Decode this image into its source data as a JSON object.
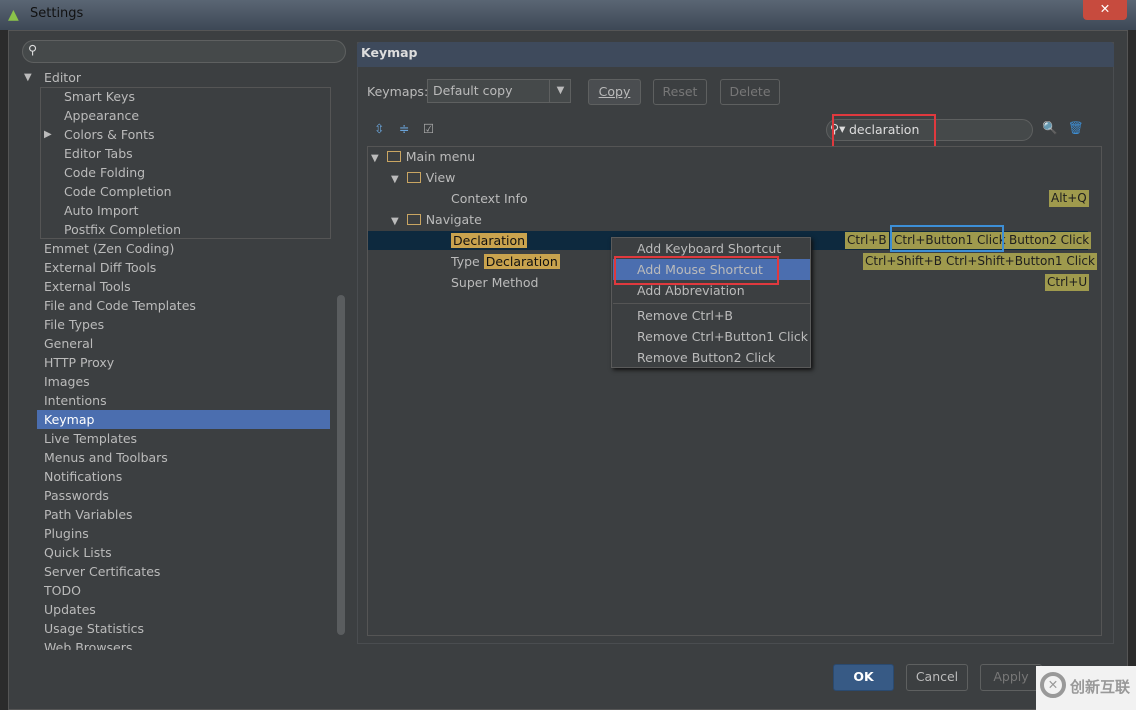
{
  "window": {
    "title": "Settings",
    "close": "✕"
  },
  "sidebar": {
    "search_placeholder": "",
    "items": [
      {
        "label": "Editor",
        "level": 0,
        "arrow": "▼"
      },
      {
        "label": "Smart Keys",
        "level": 1
      },
      {
        "label": "Appearance",
        "level": 1
      },
      {
        "label": "Colors & Fonts",
        "level": 1,
        "arrow": "▶"
      },
      {
        "label": "Editor Tabs",
        "level": 1
      },
      {
        "label": "Code Folding",
        "level": 1
      },
      {
        "label": "Code Completion",
        "level": 1
      },
      {
        "label": "Auto Import",
        "level": 1
      },
      {
        "label": "Postfix Completion",
        "level": 1
      },
      {
        "label": "Emmet (Zen Coding)"
      },
      {
        "label": "External Diff Tools"
      },
      {
        "label": "External Tools"
      },
      {
        "label": "File and Code Templates"
      },
      {
        "label": "File Types"
      },
      {
        "label": "General"
      },
      {
        "label": "HTTP Proxy"
      },
      {
        "label": "Images"
      },
      {
        "label": "Intentions"
      },
      {
        "label": "Keymap",
        "selected": true
      },
      {
        "label": "Live Templates"
      },
      {
        "label": "Menus and Toolbars"
      },
      {
        "label": "Notifications"
      },
      {
        "label": "Passwords"
      },
      {
        "label": "Path Variables"
      },
      {
        "label": "Plugins"
      },
      {
        "label": "Quick Lists"
      },
      {
        "label": "Server Certificates"
      },
      {
        "label": "TODO"
      },
      {
        "label": "Updates"
      },
      {
        "label": "Usage Statistics"
      },
      {
        "label": "Web Browsers"
      }
    ]
  },
  "main": {
    "title": "Keymap",
    "keymaps_label": "Keymaps:",
    "keymap_value": "Default copy",
    "copy": "Copy",
    "reset": "Reset",
    "delete": "Delete",
    "search_value": "declaration",
    "tree": {
      "main_menu": "Main menu",
      "view": "View",
      "context_info": "Context Info",
      "navigate": "Navigate",
      "declaration": "Declaration",
      "type_prefix": "Type ",
      "super_method": "Super Method"
    },
    "shortcuts": {
      "alt_q": "Alt+Q",
      "ctrl_b": "Ctrl+B",
      "ctrl_button1": "Ctrl+Button1 Click",
      "button2": "Button2 Click",
      "ctrl_shift_b": "Ctrl+Shift+B",
      "ctrl_shift_button1": "Ctrl+Shift+Button1 Click",
      "ctrl_u": "Ctrl+U"
    }
  },
  "context_menu": [
    "Add Keyboard Shortcut",
    "Add Mouse Shortcut",
    "Add Abbreviation",
    "Remove Ctrl+B",
    "Remove Ctrl+Button1 Click",
    "Remove Button2 Click"
  ],
  "footer": {
    "ok": "OK",
    "cancel": "Cancel",
    "apply": "Apply"
  },
  "watermark": {
    "text": "创新互联"
  },
  "colors": {
    "selection": "#4b6eaf",
    "shortcut": "#9f9a4d",
    "highlight_box": "#e0393e",
    "focus_box": "#3d8fd6"
  }
}
